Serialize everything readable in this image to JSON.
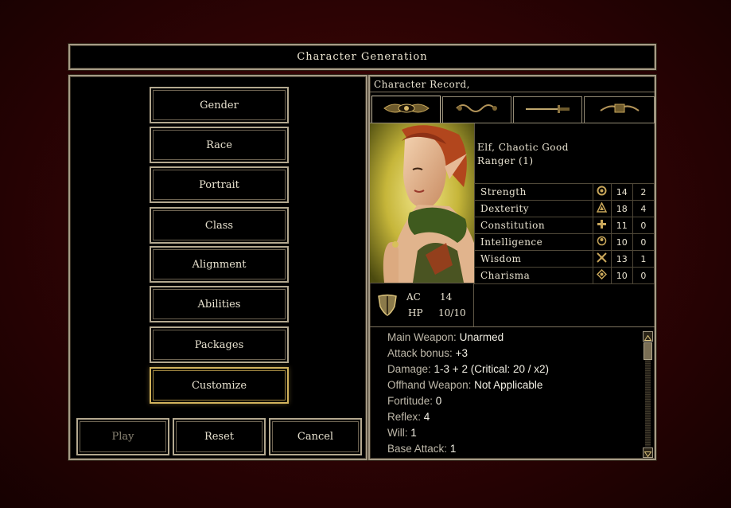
{
  "window": {
    "title": "Character Generation"
  },
  "steps": [
    {
      "label": "Gender",
      "selected": false
    },
    {
      "label": "Race",
      "selected": false
    },
    {
      "label": "Portrait",
      "selected": false
    },
    {
      "label": "Class",
      "selected": false
    },
    {
      "label": "Alignment",
      "selected": false
    },
    {
      "label": "Abilities",
      "selected": false
    },
    {
      "label": "Packages",
      "selected": false
    },
    {
      "label": "Customize",
      "selected": true
    }
  ],
  "actions": {
    "play": "Play",
    "reset": "Reset",
    "cancel": "Cancel"
  },
  "record": {
    "header": "Character Record,",
    "tabs": [
      "eye-emblem-icon",
      "scroll-emblem-icon",
      "sword-emblem-icon",
      "book-emblem-icon"
    ],
    "race_alignment": "Elf, Chaotic Good",
    "class_level": "Ranger (1)",
    "abilities": [
      {
        "name": "Strength",
        "icon": "strength-icon",
        "score": "14",
        "mod": "2"
      },
      {
        "name": "Dexterity",
        "icon": "dexterity-icon",
        "score": "18",
        "mod": "4"
      },
      {
        "name": "Constitution",
        "icon": "constitution-icon",
        "score": "11",
        "mod": "0"
      },
      {
        "name": "Intelligence",
        "icon": "intelligence-icon",
        "score": "10",
        "mod": "0"
      },
      {
        "name": "Wisdom",
        "icon": "wisdom-icon",
        "score": "13",
        "mod": "1"
      },
      {
        "name": "Charisma",
        "icon": "charisma-icon",
        "score": "10",
        "mod": "0"
      }
    ],
    "ac_label": "AC",
    "ac_value": "14",
    "hp_label": "HP",
    "hp_value": "10/10",
    "stats": [
      {
        "label": "Main Weapon:",
        "value": "Unarmed"
      },
      {
        "label": "Attack bonus:",
        "value": "+3"
      },
      {
        "label": "Damage:",
        "value": "1-3 + 2 (Critical: 20 / x2)"
      },
      {
        "label": "Offhand Weapon:",
        "value": "Not Applicable"
      },
      {
        "label": "Fortitude:",
        "value": "0"
      },
      {
        "label": "Reflex:",
        "value": "4"
      },
      {
        "label": "Will:",
        "value": "1"
      },
      {
        "label": "Base Attack:",
        "value": "1"
      }
    ]
  },
  "colors": {
    "background": "#2c0304",
    "frame": "#a59b86",
    "selected_border": "#d2b35d",
    "text": "#e8e2d0"
  }
}
